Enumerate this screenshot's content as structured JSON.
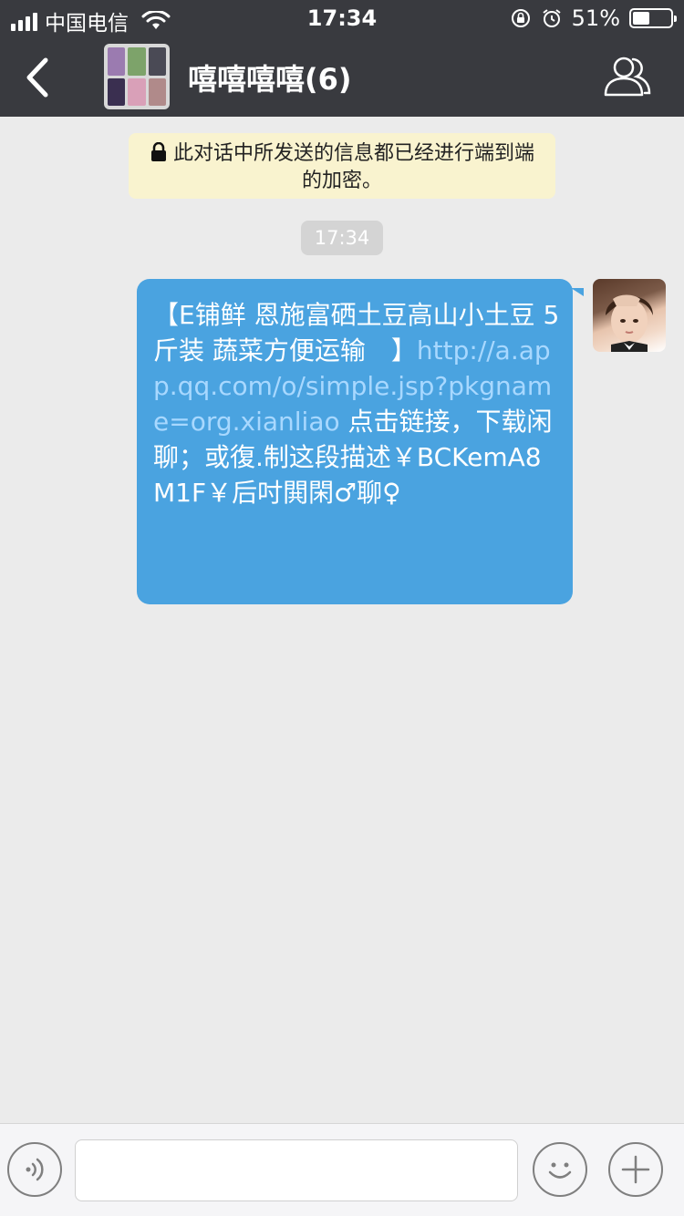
{
  "status_bar": {
    "carrier": "中国电信",
    "time": "17:34",
    "battery_percent": "51%",
    "battery_level": 0.51
  },
  "nav": {
    "title": "嘻嘻嘻嘻(6)",
    "group_avatar_colors": [
      "#9b7bb0",
      "#7da36a",
      "#4a4a55",
      "#3a2f50",
      "#d9a0b8",
      "#b08a8a"
    ]
  },
  "chat": {
    "encryption_notice": "此对话中所发送的信息都已经进行端到端的加密。",
    "timestamp": "17:34",
    "message": {
      "text_before": "【E铺鲜 恩施富硒土豆高山小土豆 5斤装 蔬菜方便运输　】",
      "link": "http://a.app.qq.com/o/simple.jsp?pkgname=org.xianliao",
      "text_after": " 点击链接，下载闲聊；或復.制这段描述￥BCKemA8M1F￥后吋閧閑♂聊♀"
    }
  },
  "input_bar": {
    "placeholder": "",
    "value": ""
  },
  "colors": {
    "nav_bg": "#393a3f",
    "chat_bg": "#ebebeb",
    "bubble": "#4aa3e0",
    "link": "#a8d8ff",
    "notice_bg": "#f9f3cf"
  },
  "icons": [
    "signal-icon",
    "wifi-icon",
    "orientation-lock-icon",
    "alarm-icon",
    "battery-icon",
    "back-arrow-icon",
    "members-icon",
    "lock-icon",
    "voice-icon",
    "emoji-icon",
    "plus-icon"
  ]
}
